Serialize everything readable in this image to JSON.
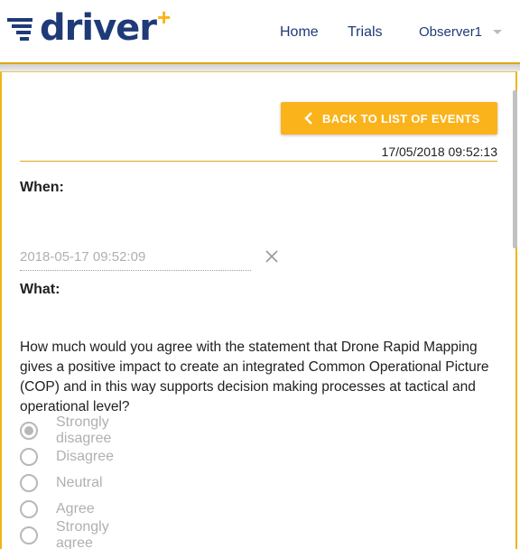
{
  "brand": {
    "name": "driver",
    "plus": "+",
    "colors": {
      "navy": "#1f3a78",
      "gold": "#fbb317"
    }
  },
  "nav": {
    "home": "Home",
    "trials": "Trials",
    "user": "Observer1"
  },
  "toolbar": {
    "back_label": "BACK TO LIST OF EVENTS",
    "back_icon": "chevron-left-icon"
  },
  "event": {
    "timestamp": "17/05/2018 09:52:13"
  },
  "form": {
    "when_label": "When:",
    "when_value": "2018-05-17 09:52:09",
    "clear_icon": "close-icon",
    "what_label": "What:",
    "question": "How much would you agree with the statement that Drone Rapid Mapping gives a positive impact to create an integrated Common Operational Picture (COP) and in this way supports decision making processes at tactical and operational level?",
    "options": [
      {
        "label": "Strongly disagree",
        "selected": true
      },
      {
        "label": "Disagree",
        "selected": false
      },
      {
        "label": "Neutral",
        "selected": false
      },
      {
        "label": "Agree",
        "selected": false
      },
      {
        "label": "Strongly agree",
        "selected": false
      }
    ]
  }
}
